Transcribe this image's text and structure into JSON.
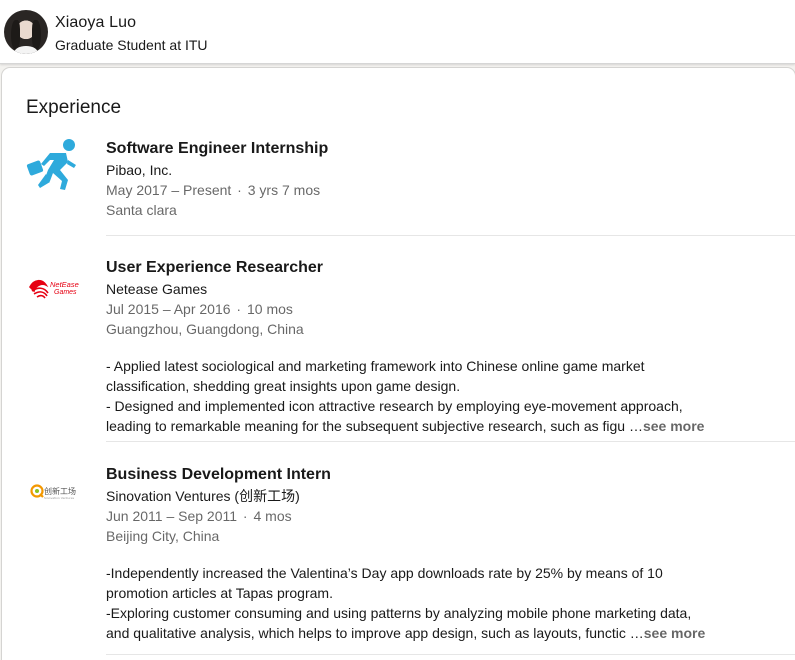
{
  "profile": {
    "name": "Xiaoya Luo",
    "headline": "Graduate Student at ITU"
  },
  "experience": {
    "title": "Experience",
    "items": [
      {
        "role": "Software Engineer Internship",
        "company": "Pibao, Inc.",
        "dates": "May 2017 – Present",
        "duration": "3 yrs 7 mos",
        "location": "Santa clara",
        "logo_icon": "running-man-icon",
        "description": []
      },
      {
        "role": "User Experience Researcher",
        "company": "Netease Games",
        "dates": "Jul 2015 – Apr 2016",
        "duration": "10 mos",
        "location": "Guangzhou, Guangdong, China",
        "logo_icon": "netease-games-logo",
        "logo_text": "NetEase Games",
        "description": [
          "- Applied latest sociological and marketing framework into Chinese online game market",
          "classification, shedding great insights upon game design.",
          "- Designed and implemented icon attractive research by employing eye-movement approach,",
          "leading to remarkable meaning for the subsequent subjective research, such as figu …"
        ],
        "see_more": "see more"
      },
      {
        "role": "Business Development Intern",
        "company": "Sinovation Ventures (创新工场)",
        "dates": "Jun 2011 – Sep 2011",
        "duration": "4 mos",
        "location": "Beijing City, China",
        "logo_icon": "sinovation-ventures-logo",
        "logo_text": "创新工场",
        "description": [
          "-Independently increased the Valentina’s Day app downloads rate by 25% by means of 10",
          "promotion articles at Tapas program.",
          "-Exploring customer consuming and using patterns by analyzing mobile phone marketing data,",
          "and qualitative analysis, which helps to improve app design, such as layouts, functic …"
        ],
        "see_more": "see more"
      }
    ]
  },
  "colors": {
    "runner_blue": "#2eaadc",
    "netease_red": "#e60012",
    "sinovation_orange": "#f39800"
  }
}
